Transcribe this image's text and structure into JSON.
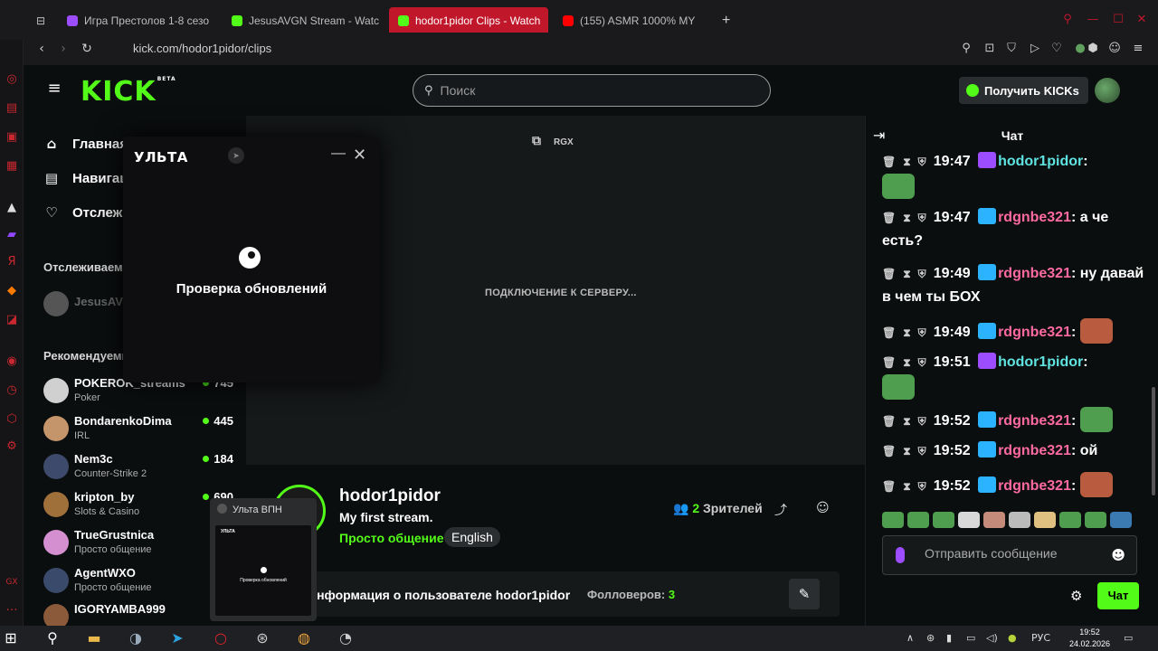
{
  "browser": {
    "tabs": [
      {
        "label": "Игра Престолов 1-8 сезо",
        "color": "#9b4dff"
      },
      {
        "label": "JesusAVGN Stream - Watc",
        "color": "#53fc18"
      },
      {
        "label": "hodor1pidor Clips - Watch",
        "color": "#53fc18",
        "active": true
      },
      {
        "label": "(155) ASMR 1000% MY",
        "color": "#ff0000"
      }
    ],
    "new_tab": "+",
    "url": "kick.com/hodor1pidor/clips"
  },
  "header": {
    "logo": "KICK",
    "logo_tag": "BETA",
    "search_placeholder": "Поиск",
    "get_kicks": "Получить KICKs"
  },
  "nav": {
    "items": [
      {
        "label": "Главная",
        "icon": "home-icon"
      },
      {
        "label": "Навигация",
        "icon": "browse-icon"
      },
      {
        "label": "Отслеживаемые",
        "icon": "heart-icon"
      }
    ],
    "followed_title": "Отслеживаемые",
    "followed": [
      {
        "name": "JesusAVGN"
      }
    ],
    "recommended_title": "Рекомендуемые",
    "recommended": [
      {
        "name": "POKEROK_streams",
        "category": "Poker",
        "viewers": "745",
        "color": "#d0d0d0"
      },
      {
        "name": "BondarenkoDima",
        "category": "IRL",
        "viewers": "445",
        "color": "#c4956a"
      },
      {
        "name": "Nem3c",
        "category": "Counter-Strike 2",
        "viewers": "184",
        "color": "#3d4a6b"
      },
      {
        "name": "kripton_by",
        "category": "Slots & Casino",
        "viewers": "690",
        "color": "#a0703a"
      },
      {
        "name": "TrueGrustnica",
        "category": "Просто общение",
        "viewers": "",
        "color": "#d48fd1"
      },
      {
        "name": "AgentWXO",
        "category": "Просто общение",
        "viewers": "",
        "color": "#3a4a6a"
      },
      {
        "name": "IGORYAMBA999",
        "category": "Просто общение",
        "viewers": "",
        "color": "#8a5a3a"
      }
    ]
  },
  "player": {
    "status": "ПОДКЛЮЧЕНИЕ К СЕРВЕРУ...",
    "label": "RGX"
  },
  "vpn": {
    "logo": "УЛЬТА",
    "status": "Проверка обновлений",
    "mini_title": "Ульта ВПН"
  },
  "channel": {
    "name": "hodor1pidor",
    "title": "My first stream.",
    "category": "Просто общение",
    "language": "English",
    "viewers_count": "2",
    "viewers_label": "Зрителей",
    "about": "Информация о пользователе hodor1pidor",
    "followers_label": "Фолловеров:",
    "followers_count": "3"
  },
  "chat": {
    "title": "Чат",
    "messages": [
      {
        "time": "19:47",
        "user": "hodor1pidor",
        "text": ""
      },
      {
        "time": "19:47",
        "user": "rdgnbe321",
        "text": "а че есть?"
      },
      {
        "time": "19:49",
        "user": "rdgnbe321",
        "text": "ну давай в чем ты БОХ"
      },
      {
        "time": "19:49",
        "user": "rdgnbe321",
        "text": ""
      },
      {
        "time": "19:51",
        "user": "hodor1pidor",
        "text": ""
      },
      {
        "time": "19:52",
        "user": "rdgnbe321",
        "text": ""
      },
      {
        "time": "19:52",
        "user": "rdgnbe321",
        "text": "ой"
      },
      {
        "time": "19:52",
        "user": "rdgnbe321",
        "text": ""
      }
    ],
    "input_placeholder": "Отправить сообщение",
    "send_label": "Чат"
  },
  "taskbar": {
    "lang": "РУС",
    "time": "19:52",
    "date": "24.02.2026"
  }
}
